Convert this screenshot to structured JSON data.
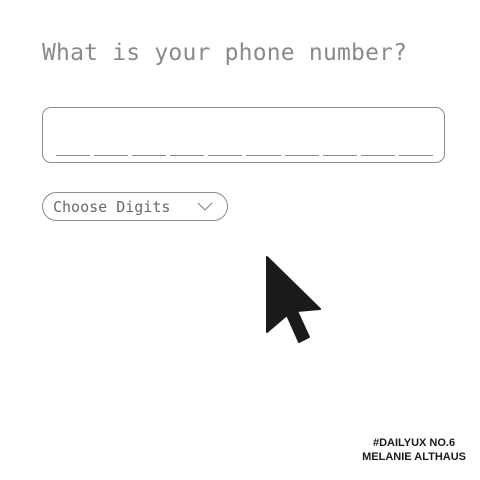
{
  "question": "What is your phone number?",
  "phone_input": {
    "value": "",
    "digit_slots": 10
  },
  "digits_select": {
    "label": "Choose Digits",
    "icon": "chevron-down-icon"
  },
  "cursor": {
    "icon": "mouse-pointer-icon"
  },
  "credit": {
    "line1": "#DAILYUX NO.6",
    "line2": "MELANIE ALTHAUS"
  },
  "colors": {
    "text_muted": "#8a8a8a",
    "border": "#8c8c8c",
    "cursor": "#1a1a1a"
  }
}
